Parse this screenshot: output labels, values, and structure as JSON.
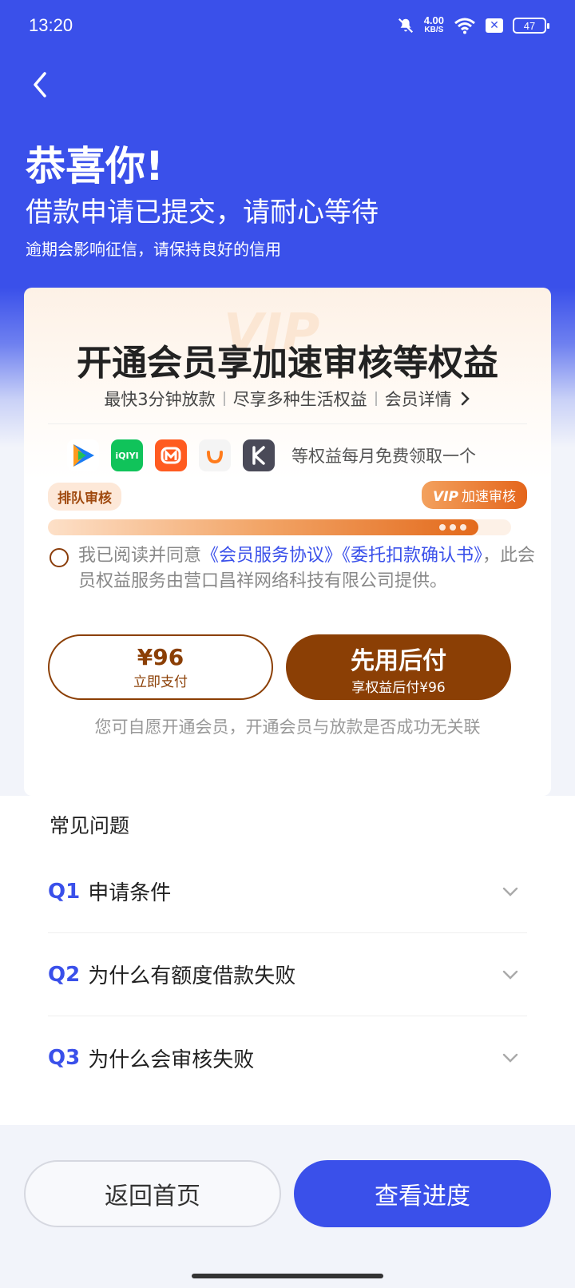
{
  "status_bar": {
    "time": "13:20",
    "net_speed": "4.00",
    "net_unit": "KB/S",
    "battery": "47"
  },
  "hero": {
    "title": "恭喜你!",
    "subtitle": "借款申请已提交，请耐心等待",
    "note": "逾期会影响征信，请保持良好的信用"
  },
  "membership": {
    "watermark": "VIP",
    "title": "开通会员享加速审核等权益",
    "perks": [
      "最快3分钟放款",
      "尽享多种生活权益",
      "会员详情"
    ],
    "apps": [
      {
        "name": "tencent-video-icon",
        "color": "#1b7cf3"
      },
      {
        "name": "iqiyi-icon",
        "label": "iQIYI",
        "color": "#10c35a"
      },
      {
        "name": "mango-tv-icon",
        "color": "#ff5b20"
      },
      {
        "name": "didi-icon",
        "color": "#ff7b1b"
      },
      {
        "name": "kuaishou-k-icon",
        "color": "#4a4a58"
      }
    ],
    "apps_note": "等权益每月免费领取一个",
    "queue_label": "排队审核",
    "vip_label": "VIP",
    "fast_label": "加速审核",
    "progress": 0.93,
    "agreement": {
      "prefix": "我已阅读并同意",
      "link1": "《会员服务协议》",
      "link2": "《委托扣款确认书》",
      "suffix": "，此会员权益服务由营口昌祥网络科技有限公司提供。"
    },
    "pay_button": {
      "price": "¥96",
      "label": "立即支付"
    },
    "later_button": {
      "label": "先用后付",
      "sub": "享权益后付¥96"
    },
    "disclaimer": "您可自愿开通会员，开通会员与放款是否成功无关联"
  },
  "faq": {
    "title": "常见问题",
    "items": [
      {
        "q": "Q1",
        "text": "申请条件"
      },
      {
        "q": "Q2",
        "text": "为什么有额度借款失败"
      },
      {
        "q": "Q3",
        "text": "为什么会审核失败"
      }
    ]
  },
  "bottom": {
    "home_label": "返回首页",
    "progress_label": "查看进度"
  },
  "colors": {
    "primary": "#3a50ea",
    "brown": "#8b3f05",
    "orange": "#e4651b"
  }
}
